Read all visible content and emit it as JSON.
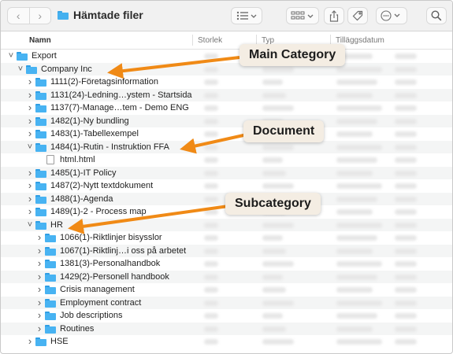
{
  "window": {
    "title": "Hämtade filer"
  },
  "toolbar": {
    "back_icon": "chevron-left-icon",
    "forward_icon": "chevron-right-icon",
    "view_icon": "list-view-icon",
    "group_icon": "grid-group-icon",
    "share_icon": "share-icon",
    "tag_icon": "tag-icon",
    "more_icon": "ellipsis-circle-icon",
    "search_icon": "search-icon"
  },
  "columns": {
    "name": "Namn",
    "size": "Storlek",
    "type": "Typ",
    "date_added": "Tilläggsdatum"
  },
  "rows": [
    {
      "label": "Export",
      "kind": "folder",
      "depth": 0,
      "expanded": true
    },
    {
      "label": "Company Inc",
      "kind": "folder",
      "depth": 1,
      "expanded": true
    },
    {
      "label": "1111(2)-Företagsinformation",
      "kind": "folder",
      "depth": 2,
      "expanded": false
    },
    {
      "label": "1131(24)-Ledning…ystem - Startsida",
      "kind": "folder",
      "depth": 2,
      "expanded": false
    },
    {
      "label": "1137(7)-Manage…tem - Demo ENG",
      "kind": "folder",
      "depth": 2,
      "expanded": false
    },
    {
      "label": "1482(1)-Ny bundling",
      "kind": "folder",
      "depth": 2,
      "expanded": false
    },
    {
      "label": "1483(1)-Tabellexempel",
      "kind": "folder",
      "depth": 2,
      "expanded": false
    },
    {
      "label": "1484(1)-Rutin - Instruktion FFA",
      "kind": "folder",
      "depth": 2,
      "expanded": true
    },
    {
      "label": "html.html",
      "kind": "file",
      "depth": 3,
      "expanded": false
    },
    {
      "label": "1485(1)-IT Policy",
      "kind": "folder",
      "depth": 2,
      "expanded": false
    },
    {
      "label": "1487(2)-Nytt textdokument",
      "kind": "folder",
      "depth": 2,
      "expanded": false
    },
    {
      "label": "1488(1)-Agenda",
      "kind": "folder",
      "depth": 2,
      "expanded": false
    },
    {
      "label": "1489(1)-2 - Process map",
      "kind": "folder",
      "depth": 2,
      "expanded": false
    },
    {
      "label": "HR",
      "kind": "folder",
      "depth": 2,
      "expanded": true
    },
    {
      "label": "1066(1)-Riktlinjer bisysslor",
      "kind": "folder",
      "depth": 3,
      "expanded": false
    },
    {
      "label": "1067(1)-Riktlinj…i oss på arbetet",
      "kind": "folder",
      "depth": 3,
      "expanded": false
    },
    {
      "label": "1381(3)-Personalhandbok",
      "kind": "folder",
      "depth": 3,
      "expanded": false
    },
    {
      "label": "1429(2)-Personell handbook",
      "kind": "folder",
      "depth": 3,
      "expanded": false
    },
    {
      "label": "Crisis management",
      "kind": "folder",
      "depth": 3,
      "expanded": false
    },
    {
      "label": "Employment contract",
      "kind": "folder",
      "depth": 3,
      "expanded": false
    },
    {
      "label": "Job descriptions",
      "kind": "folder",
      "depth": 3,
      "expanded": false
    },
    {
      "label": "Routines",
      "kind": "folder",
      "depth": 3,
      "expanded": false
    },
    {
      "label": "HSE",
      "kind": "folder",
      "depth": 2,
      "expanded": false
    }
  ],
  "annotations": [
    {
      "label": "Main Category",
      "row_index": 1
    },
    {
      "label": "Document",
      "row_index": 7
    },
    {
      "label": "Subcategory",
      "row_index": 13
    }
  ],
  "colors": {
    "annotation_arrow": "#f08a16",
    "annotation_bg": "#f4ede3",
    "folder_blue": "#48b3f2"
  }
}
